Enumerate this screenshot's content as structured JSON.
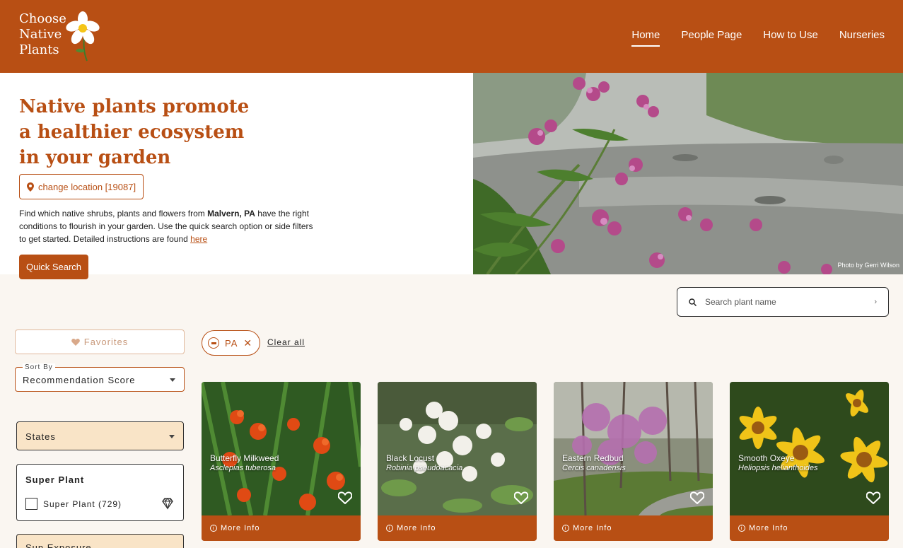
{
  "header": {
    "logo_lines": [
      "Choose",
      "Native",
      "Plants"
    ],
    "nav": [
      {
        "label": "Home",
        "active": true
      },
      {
        "label": "People Page",
        "active": false
      },
      {
        "label": "How to Use",
        "active": false
      },
      {
        "label": "Nurseries",
        "active": false
      }
    ],
    "brand_color": "#b84f14"
  },
  "hero": {
    "title": "Native plants promote a healthier ecosystem in your garden",
    "location_button": "change location [19087]",
    "desc_before": "Find which native shrubs, plants and flowers from ",
    "desc_place": "Malvern, PA",
    "desc_after": " have the right conditions to flourish in your garden. Use the quick search option or side filters to get started. Detailed instructions are found ",
    "desc_link": "here",
    "quick_search": "Quick Search",
    "photo_credit": "Photo by Gerri Wilson"
  },
  "search": {
    "placeholder": "Search plant name"
  },
  "sidebar": {
    "favorites": "Favorites",
    "sort_label": "Sort By",
    "sort_value": "Recommendation Score",
    "states_label": "States",
    "super_plant_title": "Super Plant",
    "super_plant_option": "Super Plant (729)",
    "sun_label": "Sun Exposure"
  },
  "filters": {
    "chip_label": "PA",
    "clear_all": "Clear all"
  },
  "cards": [
    {
      "name": "Butterfly Milkweed",
      "sci": "Asclepias tuberosa",
      "more": "More Info"
    },
    {
      "name": "Black Locust",
      "sci": "Robinia pseudoacacia",
      "more": "More Info"
    },
    {
      "name": "Eastern Redbud",
      "sci": "Cercis canadensis",
      "more": "More Info"
    },
    {
      "name": "Smooth Oxeye",
      "sci": "Heliopsis helianthoides",
      "more": "More Info"
    }
  ]
}
